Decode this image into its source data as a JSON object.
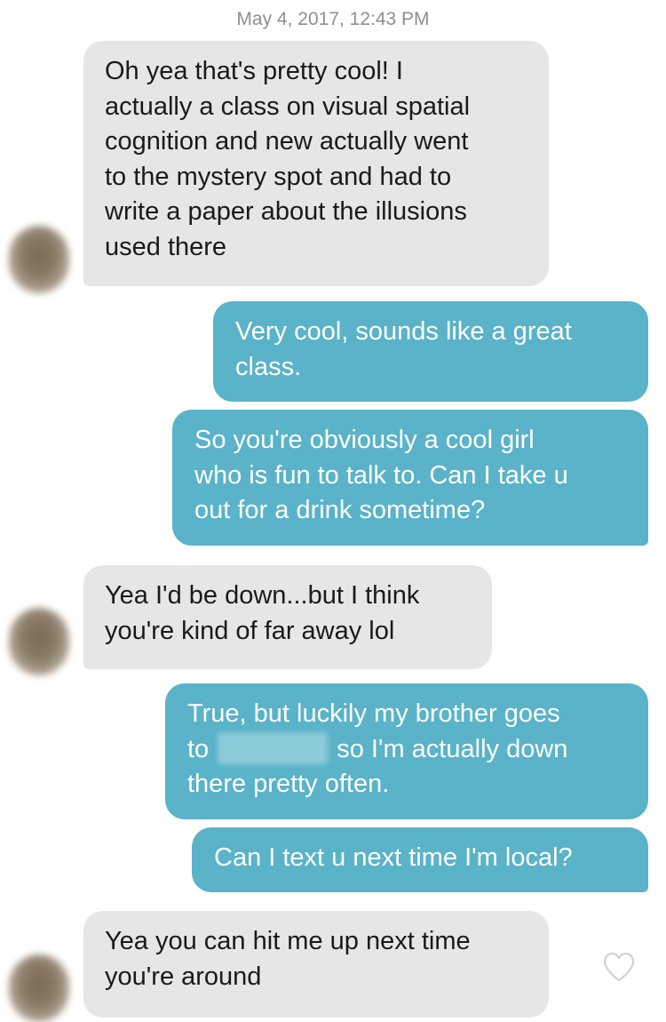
{
  "timestamp": "May 4, 2017, 12:43 PM",
  "messages": [
    {
      "from": "them",
      "lines": [
        "Oh yea that's pretty cool! I",
        "actually a class on visual spatial",
        "cognition and new actually went",
        "to the mystery spot and had to",
        "write a paper about the illusions",
        "used there"
      ]
    },
    {
      "from": "me",
      "lines": [
        "Very cool, sounds like a great",
        "class."
      ]
    },
    {
      "from": "me",
      "lines": [
        "So you're obviously a cool girl",
        "who is fun to talk to. Can I take u",
        "out for a drink sometime?"
      ]
    },
    {
      "from": "them",
      "lines": [
        "Yea I'd be down...but I think",
        "you're kind of far away lol"
      ]
    },
    {
      "from": "me",
      "lines": [
        "True, but luckily my brother goes",
        "to",
        "so I'm actually down",
        "there pretty often."
      ]
    },
    {
      "from": "me",
      "lines": [
        "Can I text u next time I'm local?"
      ]
    },
    {
      "from": "them",
      "lines": [
        "Yea you can hit me up next time",
        "you're around"
      ]
    }
  ],
  "colors": {
    "incoming_bubble": "#e6e6e6",
    "outgoing_bubble": "#5ab3c8",
    "timestamp_text": "#8e8e93"
  },
  "icons": {
    "like": "heart-outline-icon",
    "avatar": "blurred-profile-photo"
  }
}
